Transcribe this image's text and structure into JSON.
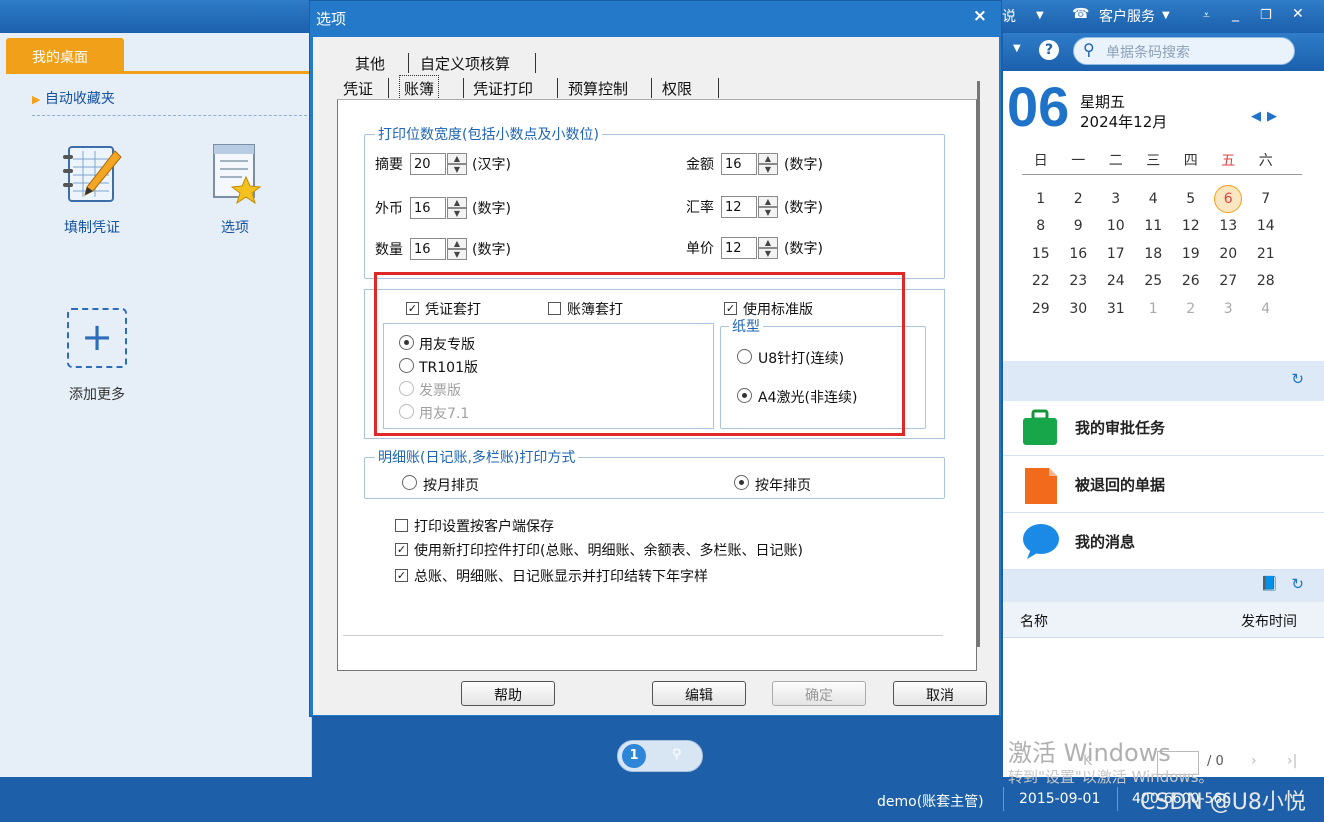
{
  "topbar": {
    "title_fragment": "说",
    "service": "客户服务",
    "service_caret": "▾"
  },
  "desktop": {
    "tab": "我的桌面",
    "favorites": "自动收藏夹",
    "icons": [
      {
        "label": "填制凭证"
      },
      {
        "label": "选项"
      },
      {
        "label": "添加更多"
      }
    ]
  },
  "right": {
    "search_placeholder": "单据条码搜索",
    "day": "06",
    "weekday": "星期五",
    "year_month": "2024年12月",
    "week_headers": [
      "日",
      "一",
      "二",
      "三",
      "四",
      "五",
      "六"
    ],
    "weeks": [
      [
        "1",
        "2",
        "3",
        "4",
        "5",
        "6",
        "7"
      ],
      [
        "8",
        "9",
        "10",
        "11",
        "12",
        "13",
        "14"
      ],
      [
        "15",
        "16",
        "17",
        "18",
        "19",
        "20",
        "21"
      ],
      [
        "22",
        "23",
        "24",
        "25",
        "26",
        "27",
        "28"
      ],
      [
        "29",
        "30",
        "31",
        "1",
        "2",
        "3",
        "4"
      ]
    ],
    "today": "6",
    "tasks": [
      "我的审批任务",
      "被退回的单据",
      "我的消息"
    ],
    "table_headers": {
      "name": "名称",
      "time": "发布时间"
    },
    "pager_page": "/ 0"
  },
  "watermark": {
    "line1": "激活 Windows",
    "line2": "转到\"设置\"以激活 Windows。",
    "credit": "CSDN @U8小悦"
  },
  "statusbar": {
    "user": "demo(账套主管)",
    "date": "2015-09-01",
    "phone": "400-6600-566"
  },
  "pager": {
    "page": "1"
  },
  "dialog": {
    "title": "选项",
    "close": "×",
    "tabs_row1": [
      "其他",
      "自定义项核算"
    ],
    "tabs_row2": [
      "凭证",
      "账簿",
      "凭证打印",
      "预算控制",
      "权限"
    ],
    "active_tab": "账簿",
    "print_width": {
      "legend": "打印位数宽度(包括小数点及小数位)",
      "fields": [
        {
          "label": "摘要",
          "value": "20",
          "unit": "(汉字)"
        },
        {
          "label": "金额",
          "value": "16",
          "unit": "(数字)"
        },
        {
          "label": "外币",
          "value": "16",
          "unit": "(数字)"
        },
        {
          "label": "汇率",
          "value": "12",
          "unit": "(数字)"
        },
        {
          "label": "数量",
          "value": "16",
          "unit": "(数字)"
        },
        {
          "label": "单价",
          "value": "12",
          "unit": "(数字)"
        }
      ]
    },
    "print_options": {
      "voucher_overlay": {
        "label": "凭证套打",
        "checked": true
      },
      "ledger_overlay": {
        "label": "账簿套打",
        "checked": false
      },
      "standard": {
        "label": "使用标准版",
        "checked": true
      },
      "versions": [
        {
          "label": "用友专版",
          "selected": true,
          "disabled": false
        },
        {
          "label": "TR101版",
          "selected": false,
          "disabled": false
        },
        {
          "label": "发票版",
          "selected": false,
          "disabled": true
        },
        {
          "label": "用友7.1",
          "selected": false,
          "disabled": true
        }
      ],
      "paper_legend": "纸型",
      "paper": [
        {
          "label": "U8针打(连续)",
          "selected": false
        },
        {
          "label": "A4激光(非连续)",
          "selected": true
        }
      ]
    },
    "detail_print": {
      "legend": "明细账(日记账,多栏账)打印方式",
      "by_month": "按月排页",
      "by_year": "按年排页",
      "selected": "by_year"
    },
    "checks": [
      {
        "label": "打印设置按客户端保存",
        "checked": false
      },
      {
        "label": "使用新打印控件打印(总账、明细账、余额表、多栏账、日记账)",
        "checked": true
      },
      {
        "label": "总账、明细账、日记账显示并打印结转下年字样",
        "checked": true
      }
    ],
    "buttons": {
      "help": "帮助",
      "edit": "编辑",
      "ok": "确定",
      "cancel": "取消"
    }
  }
}
